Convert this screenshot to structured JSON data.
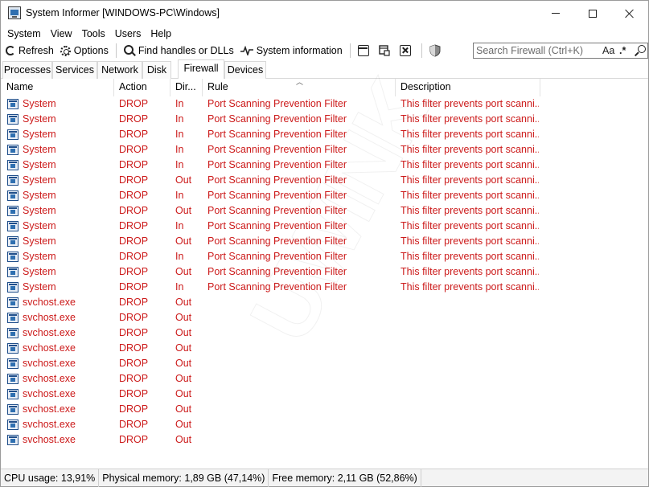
{
  "window": {
    "title": "System Informer [WINDOWS-PC\\Windows]"
  },
  "menu": [
    "System",
    "View",
    "Tools",
    "Users",
    "Help"
  ],
  "toolbar": {
    "refresh_label": "Refresh",
    "options_label": "Options",
    "find_label": "Find handles or DLLs",
    "sysinfo_label": "System information"
  },
  "search": {
    "placeholder": "Search Firewall (Ctrl+K)",
    "case_label": "Aa",
    "regex_label": ".*"
  },
  "tabs": [
    "Processes",
    "Services",
    "Network",
    "Disk",
    "Firewall",
    "Devices"
  ],
  "active_tab": "Firewall",
  "columns": {
    "name": "Name",
    "action": "Action",
    "direction": "Dir...",
    "rule": "Rule",
    "description": "Description"
  },
  "rows": [
    {
      "name": "System",
      "action": "DROP",
      "dir": "In",
      "rule": "Port Scanning Prevention Filter",
      "desc": "This filter prevents port scanni..."
    },
    {
      "name": "System",
      "action": "DROP",
      "dir": "In",
      "rule": "Port Scanning Prevention Filter",
      "desc": "This filter prevents port scanni..."
    },
    {
      "name": "System",
      "action": "DROP",
      "dir": "In",
      "rule": "Port Scanning Prevention Filter",
      "desc": "This filter prevents port scanni..."
    },
    {
      "name": "System",
      "action": "DROP",
      "dir": "In",
      "rule": "Port Scanning Prevention Filter",
      "desc": "This filter prevents port scanni..."
    },
    {
      "name": "System",
      "action": "DROP",
      "dir": "In",
      "rule": "Port Scanning Prevention Filter",
      "desc": "This filter prevents port scanni..."
    },
    {
      "name": "System",
      "action": "DROP",
      "dir": "Out",
      "rule": "Port Scanning Prevention Filter",
      "desc": "This filter prevents port scanni..."
    },
    {
      "name": "System",
      "action": "DROP",
      "dir": "In",
      "rule": "Port Scanning Prevention Filter",
      "desc": "This filter prevents port scanni..."
    },
    {
      "name": "System",
      "action": "DROP",
      "dir": "Out",
      "rule": "Port Scanning Prevention Filter",
      "desc": "This filter prevents port scanni..."
    },
    {
      "name": "System",
      "action": "DROP",
      "dir": "In",
      "rule": "Port Scanning Prevention Filter",
      "desc": "This filter prevents port scanni..."
    },
    {
      "name": "System",
      "action": "DROP",
      "dir": "Out",
      "rule": "Port Scanning Prevention Filter",
      "desc": "This filter prevents port scanni..."
    },
    {
      "name": "System",
      "action": "DROP",
      "dir": "In",
      "rule": "Port Scanning Prevention Filter",
      "desc": "This filter prevents port scanni..."
    },
    {
      "name": "System",
      "action": "DROP",
      "dir": "Out",
      "rule": "Port Scanning Prevention Filter",
      "desc": "This filter prevents port scanni..."
    },
    {
      "name": "System",
      "action": "DROP",
      "dir": "In",
      "rule": "Port Scanning Prevention Filter",
      "desc": "This filter prevents port scanni..."
    },
    {
      "name": "svchost.exe",
      "action": "DROP",
      "dir": "Out",
      "rule": "",
      "desc": ""
    },
    {
      "name": "svchost.exe",
      "action": "DROP",
      "dir": "Out",
      "rule": "",
      "desc": ""
    },
    {
      "name": "svchost.exe",
      "action": "DROP",
      "dir": "Out",
      "rule": "",
      "desc": ""
    },
    {
      "name": "svchost.exe",
      "action": "DROP",
      "dir": "Out",
      "rule": "",
      "desc": ""
    },
    {
      "name": "svchost.exe",
      "action": "DROP",
      "dir": "Out",
      "rule": "",
      "desc": ""
    },
    {
      "name": "svchost.exe",
      "action": "DROP",
      "dir": "Out",
      "rule": "",
      "desc": ""
    },
    {
      "name": "svchost.exe",
      "action": "DROP",
      "dir": "Out",
      "rule": "",
      "desc": ""
    },
    {
      "name": "svchost.exe",
      "action": "DROP",
      "dir": "Out",
      "rule": "",
      "desc": ""
    },
    {
      "name": "svchost.exe",
      "action": "DROP",
      "dir": "Out",
      "rule": "",
      "desc": ""
    },
    {
      "name": "svchost.exe",
      "action": "DROP",
      "dir": "Out",
      "rule": "",
      "desc": ""
    }
  ],
  "row_text_color": "#cc1a1a",
  "status": {
    "cpu": "CPU usage: 13,91%",
    "physical": "Physical memory: 1,89 GB (47,14%)",
    "free": "Free memory: 2,11 GB (52,86%)"
  }
}
